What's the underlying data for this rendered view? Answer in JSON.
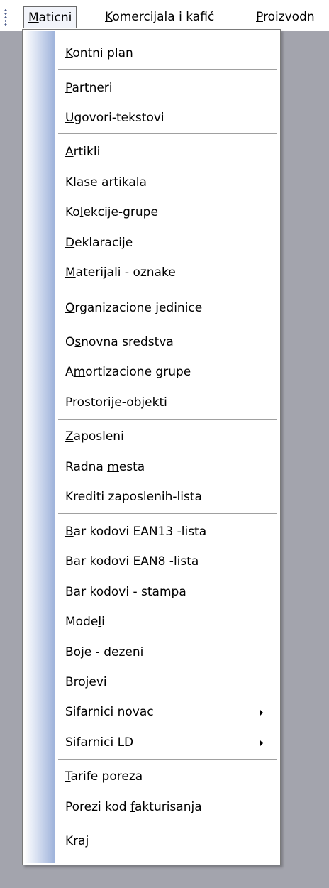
{
  "menubar": {
    "items": [
      {
        "pre": "",
        "u": "M",
        "post": "aticni"
      },
      {
        "pre": "",
        "u": "K",
        "post": "omercijala i kafić"
      },
      {
        "pre": "",
        "u": "P",
        "post": "roizvodn"
      }
    ]
  },
  "menu": {
    "items": [
      {
        "pre": "",
        "u": "K",
        "post": "ontni plan"
      },
      {
        "pre": "",
        "u": "P",
        "post": "artneri"
      },
      {
        "pre": "",
        "u": "U",
        "post": "govori-tekstovi"
      },
      {
        "pre": "",
        "u": "A",
        "post": "rtikli"
      },
      {
        "pre": "K",
        "u": "l",
        "post": "ase artikala"
      },
      {
        "pre": "Ko",
        "u": "l",
        "post": "ekcije-grupe"
      },
      {
        "pre": "",
        "u": "D",
        "post": "eklaracije"
      },
      {
        "pre": "",
        "u": "M",
        "post": "aterijali - oznake"
      },
      {
        "pre": "",
        "u": "O",
        "post": "rganizacione jedinice"
      },
      {
        "pre": "O",
        "u": "s",
        "post": "novna sredstva"
      },
      {
        "pre": "A",
        "u": "m",
        "post": "ortizacione grupe"
      },
      {
        "pre": "Prostorije-objekti",
        "u": "",
        "post": ""
      },
      {
        "pre": "",
        "u": "Z",
        "post": "aposleni"
      },
      {
        "pre": "Radna ",
        "u": "m",
        "post": "esta"
      },
      {
        "pre": "Krediti zaposlenih-lista",
        "u": "",
        "post": ""
      },
      {
        "pre": "",
        "u": "B",
        "post": "ar kodovi EAN13 -lista"
      },
      {
        "pre": "",
        "u": "B",
        "post": "ar kodovi EAN8 -lista"
      },
      {
        "pre": "Bar kodovi - stampa",
        "u": "",
        "post": ""
      },
      {
        "pre": "Mode",
        "u": "l",
        "post": "i"
      },
      {
        "pre": "Boje - dezeni",
        "u": "",
        "post": ""
      },
      {
        "pre": "Brojevi",
        "u": "",
        "post": ""
      },
      {
        "pre": "Sifarnici novac",
        "u": "",
        "post": ""
      },
      {
        "pre": "Sifarnici LD",
        "u": "",
        "post": ""
      },
      {
        "pre": "",
        "u": "T",
        "post": "arife poreza"
      },
      {
        "pre": "Porezi kod ",
        "u": "f",
        "post": "akturisanja"
      },
      {
        "pre": "Kra",
        "u": "j",
        "post": ""
      }
    ]
  }
}
